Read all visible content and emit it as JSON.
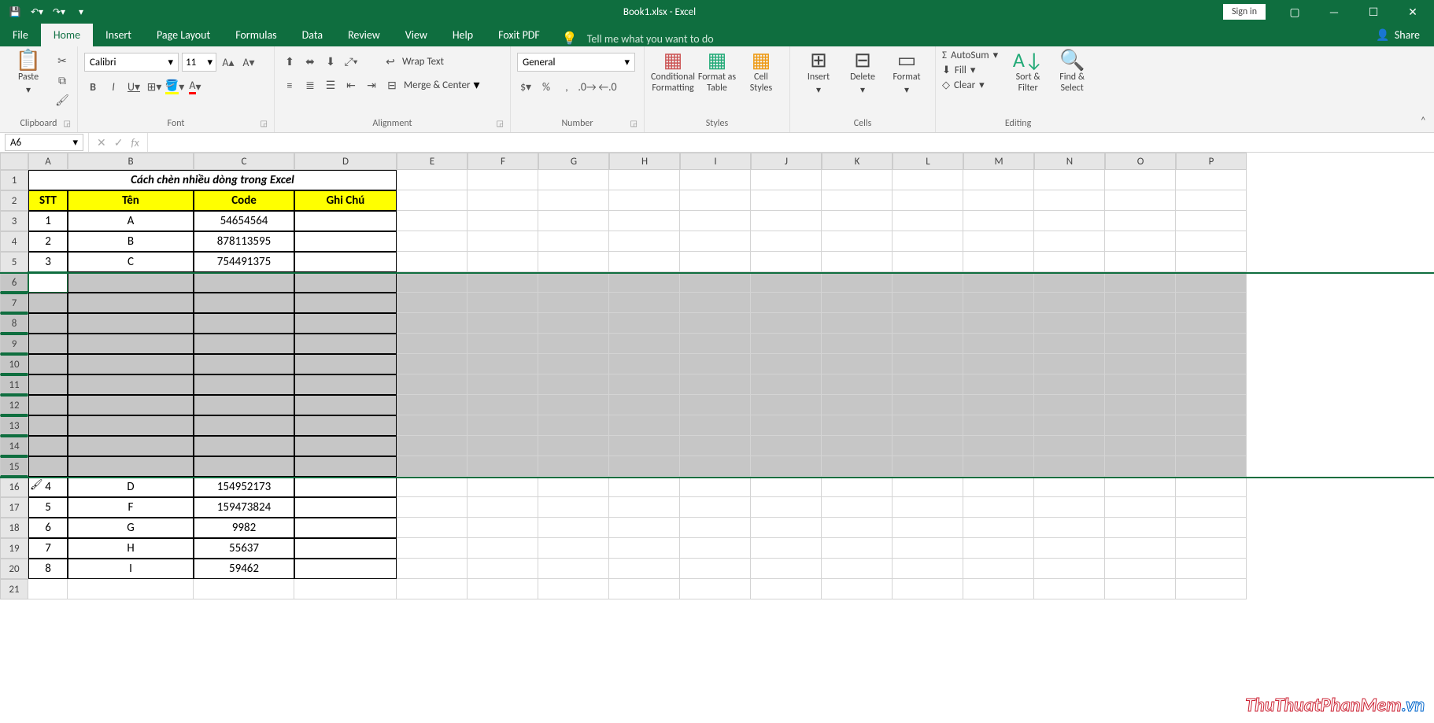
{
  "title": "Book1.xlsx - Excel",
  "signin": "Sign in",
  "tabsRow": {
    "file": "File",
    "home": "Home",
    "insert": "Insert",
    "pageLayout": "Page Layout",
    "formulas": "Formulas",
    "data": "Data",
    "review": "Review",
    "view": "View",
    "help": "Help",
    "foxit": "Foxit PDF",
    "tellme": "Tell me what you want to do",
    "share": "Share"
  },
  "ribbon": {
    "clipboard": {
      "paste": "Paste",
      "label": "Clipboard"
    },
    "font": {
      "name": "Calibri",
      "size": "11",
      "label": "Font"
    },
    "alignment": {
      "wrap": "Wrap Text",
      "merge": "Merge & Center",
      "label": "Alignment"
    },
    "number": {
      "format": "General",
      "label": "Number"
    },
    "styles": {
      "cond": "Conditional\nFormatting",
      "fat": "Format as\nTable",
      "cell": "Cell\nStyles",
      "label": "Styles"
    },
    "cells": {
      "insert": "Insert",
      "delete": "Delete",
      "format": "Format",
      "label": "Cells"
    },
    "editing": {
      "sum": "AutoSum",
      "fill": "Fill",
      "clear": "Clear",
      "sort": "Sort &\nFilter",
      "find": "Find &\nSelect",
      "label": "Editing"
    }
  },
  "namebox": "A6",
  "columns": [
    "A",
    "B",
    "C",
    "D",
    "E",
    "F",
    "G",
    "H",
    "I",
    "J",
    "K",
    "L",
    "M",
    "N",
    "O",
    "P"
  ],
  "rowCount": 21,
  "sheet": {
    "title": "Cách chèn nhiều dòng trong Excel",
    "headers": [
      "STT",
      "Tên",
      "Code",
      "Ghi Chú"
    ],
    "dataTop": [
      [
        "1",
        "A",
        "54654564",
        ""
      ],
      [
        "2",
        "B",
        "878113595",
        ""
      ],
      [
        "3",
        "C",
        "754491375",
        ""
      ]
    ],
    "dataBottom": [
      [
        "4",
        "D",
        "154952173",
        ""
      ],
      [
        "5",
        "F",
        "159473824",
        ""
      ],
      [
        "6",
        "G",
        "9982",
        ""
      ],
      [
        "7",
        "H",
        "55637",
        ""
      ],
      [
        "8",
        "I",
        "59462",
        ""
      ]
    ]
  },
  "watermark": {
    "a": "ThuThuatPhanMem",
    "b": ".vn"
  }
}
